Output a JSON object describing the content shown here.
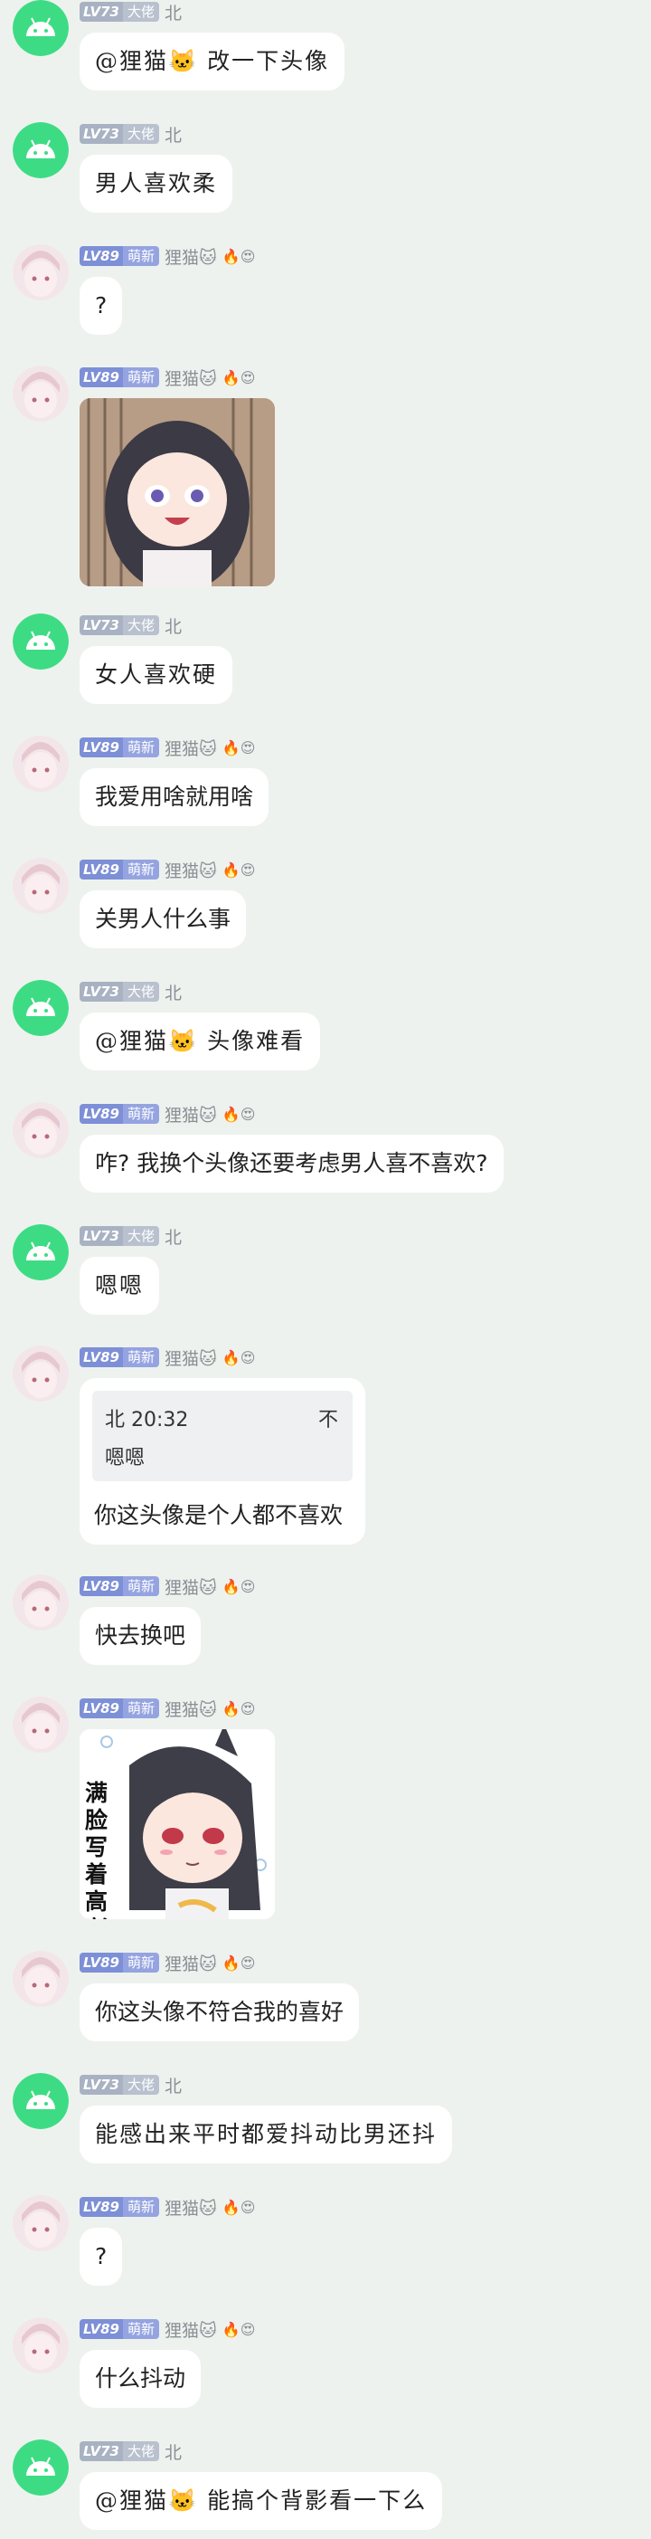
{
  "users": {
    "bei": {
      "level": "LV73",
      "title": "大佬",
      "name": "北"
    },
    "limao": {
      "level": "LV89",
      "title": "萌新",
      "name": "狸猫🐱",
      "badges": "🔥😍"
    }
  },
  "messages": [
    {
      "user": "bei",
      "text": "@狸猫🐱 改一下头像"
    },
    {
      "user": "bei",
      "text": "男人喜欢柔"
    },
    {
      "user": "limao",
      "text": "?"
    },
    {
      "user": "limao",
      "image": "sticker-girl-shocked"
    },
    {
      "user": "bei",
      "text": "女人喜欢硬"
    },
    {
      "user": "limao",
      "text": "我爱用啥就用啥"
    },
    {
      "user": "limao",
      "text": "关男人什么事"
    },
    {
      "user": "bei",
      "text": "@狸猫🐱 头像难看"
    },
    {
      "user": "limao",
      "text": "咋? 我换个头像还要考虑男人喜不喜欢?"
    },
    {
      "user": "bei",
      "text": "嗯嗯"
    },
    {
      "user": "limao",
      "quote": {
        "author_time": "北 20:32",
        "extra": "不",
        "text": "嗯嗯"
      },
      "text": "你这头像是个人都不喜欢"
    },
    {
      "user": "limao",
      "text": "快去换吧"
    },
    {
      "user": "limao",
      "image": "sticker-happy-girl",
      "image_text": "满脸写着高兴"
    },
    {
      "user": "limao",
      "text": "你这头像不符合我的喜好"
    },
    {
      "user": "bei",
      "text": "能感出来平时都爱抖动比男还抖"
    },
    {
      "user": "limao",
      "text": "?"
    },
    {
      "user": "limao",
      "text": "什么抖动"
    },
    {
      "user": "bei",
      "text": "@狸猫🐱 能搞个背影看一下么"
    }
  ],
  "colors": {
    "background": "#eef2ee",
    "bubble": "#ffffff",
    "android_green": "#3ddc84",
    "level_new": "#7d8fd6",
    "level_big": "#a8b2c2"
  }
}
